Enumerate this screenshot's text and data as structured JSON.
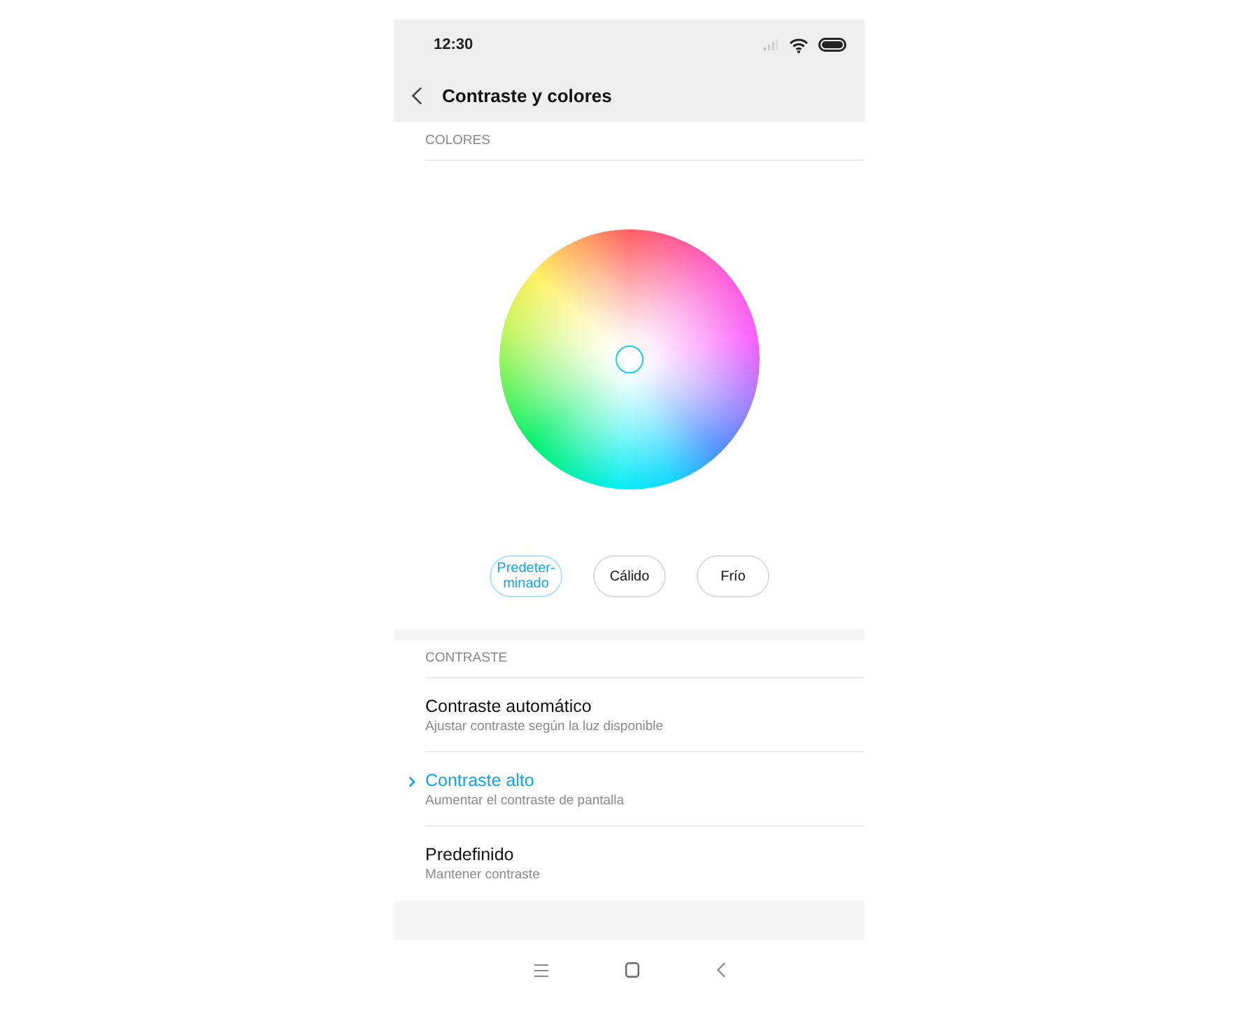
{
  "status_bar": {
    "time": "12:30"
  },
  "header": {
    "title": "Contraste y colores"
  },
  "colors_section": {
    "heading": "COLORES",
    "presets": [
      {
        "label": "Predeter-\nminado",
        "selected": true
      },
      {
        "label": "Cálido",
        "selected": false
      },
      {
        "label": "Frío",
        "selected": false
      }
    ]
  },
  "contrast_section": {
    "heading": "CONTRASTE",
    "options": [
      {
        "title": "Contraste automático",
        "subtitle": "Ajustar contraste según la luz disponible",
        "selected": false
      },
      {
        "title": "Contraste alto",
        "subtitle": "Aumentar el contraste de pantalla",
        "selected": true
      },
      {
        "title": "Predefinido",
        "subtitle": "Mantener contraste",
        "selected": false
      }
    ]
  }
}
